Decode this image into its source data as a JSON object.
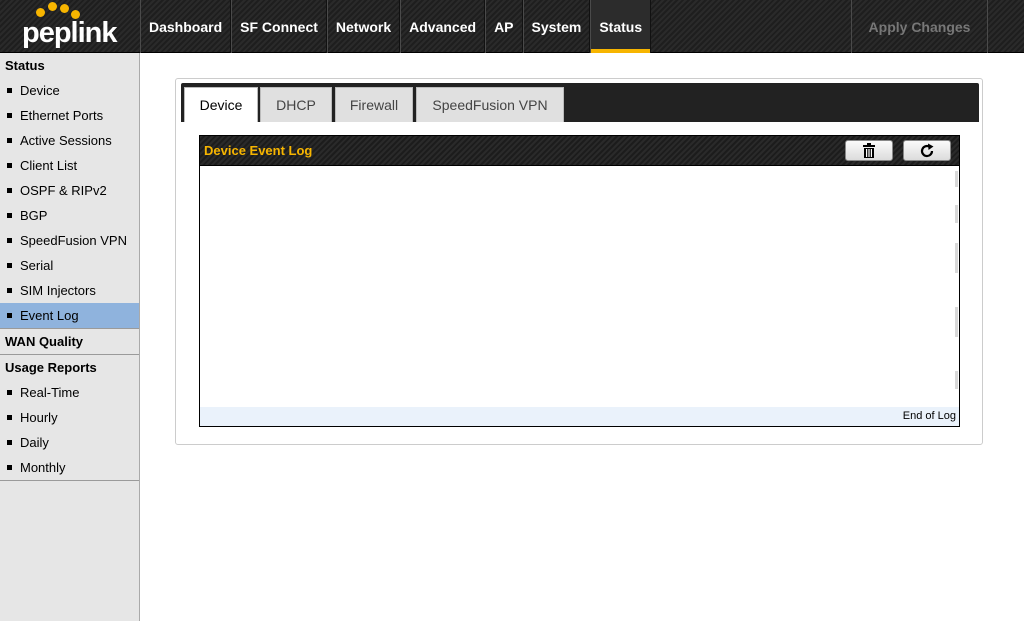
{
  "brand": {
    "logo_text": "peplink",
    "accent": "#f7b500"
  },
  "nav": {
    "items": [
      {
        "label": "Dashboard"
      },
      {
        "label": "SF Connect"
      },
      {
        "label": "Network"
      },
      {
        "label": "Advanced"
      },
      {
        "label": "AP"
      },
      {
        "label": "System"
      },
      {
        "label": "Status"
      }
    ],
    "active": "Status",
    "apply_label": "Apply Changes"
  },
  "sidebar": {
    "status_heading": "Status",
    "status_items": [
      {
        "label": "Device"
      },
      {
        "label": "Ethernet Ports"
      },
      {
        "label": "Active Sessions"
      },
      {
        "label": "Client List"
      },
      {
        "label": "OSPF & RIPv2"
      },
      {
        "label": "BGP"
      },
      {
        "label": "SpeedFusion VPN"
      },
      {
        "label": "Serial"
      },
      {
        "label": "SIM Injectors"
      },
      {
        "label": "Event Log"
      }
    ],
    "active_item": "Event Log",
    "wan_quality_heading": "WAN Quality",
    "usage_heading": "Usage Reports",
    "usage_items": [
      {
        "label": "Real-Time"
      },
      {
        "label": "Hourly"
      },
      {
        "label": "Daily"
      },
      {
        "label": "Monthly"
      }
    ]
  },
  "tabs": [
    {
      "label": "Device"
    },
    {
      "label": "DHCP"
    },
    {
      "label": "Firewall"
    },
    {
      "label": "SpeedFusion VPN"
    }
  ],
  "active_tab": "Device",
  "log": {
    "title": "Device Event Log",
    "clear_icon": "trash-icon",
    "refresh_icon": "refresh-icon",
    "end_text": "End of Log"
  }
}
